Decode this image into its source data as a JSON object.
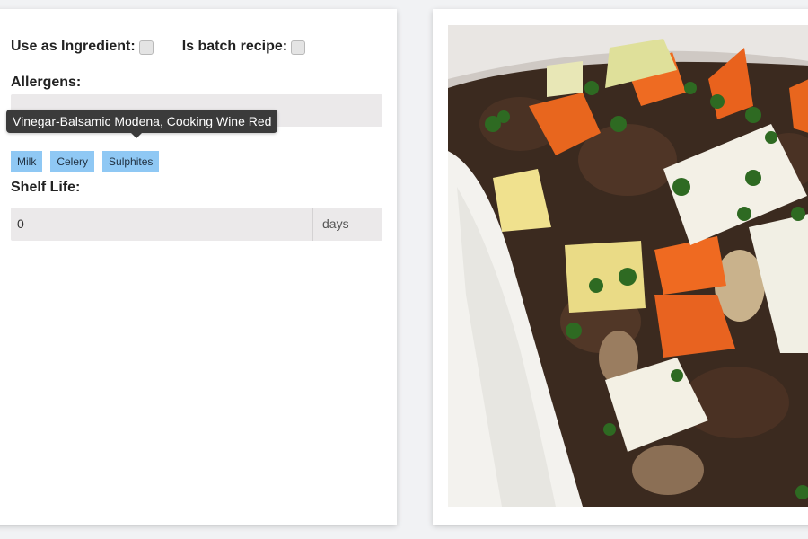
{
  "form": {
    "use_as_ingredient_label": "Use as Ingredient:",
    "is_batch_recipe_label": "Is batch recipe:",
    "allergens_label": "Allergens:",
    "allergen_input_placeholder": "",
    "tooltip_text": "Vinegar-Balsamic Modena, Cooking Wine Red",
    "allergen_chips": [
      "Milk",
      "Celery",
      "Sulphites"
    ],
    "shelf_life_label": "Shelf Life:",
    "shelf_life_value": "0",
    "shelf_life_unit": "days"
  },
  "colors": {
    "chip_background": "#8fc8f4",
    "input_background": "#ebe9ea",
    "tooltip_background": "#3b3b3b",
    "page_background": "#f1f2f4"
  }
}
